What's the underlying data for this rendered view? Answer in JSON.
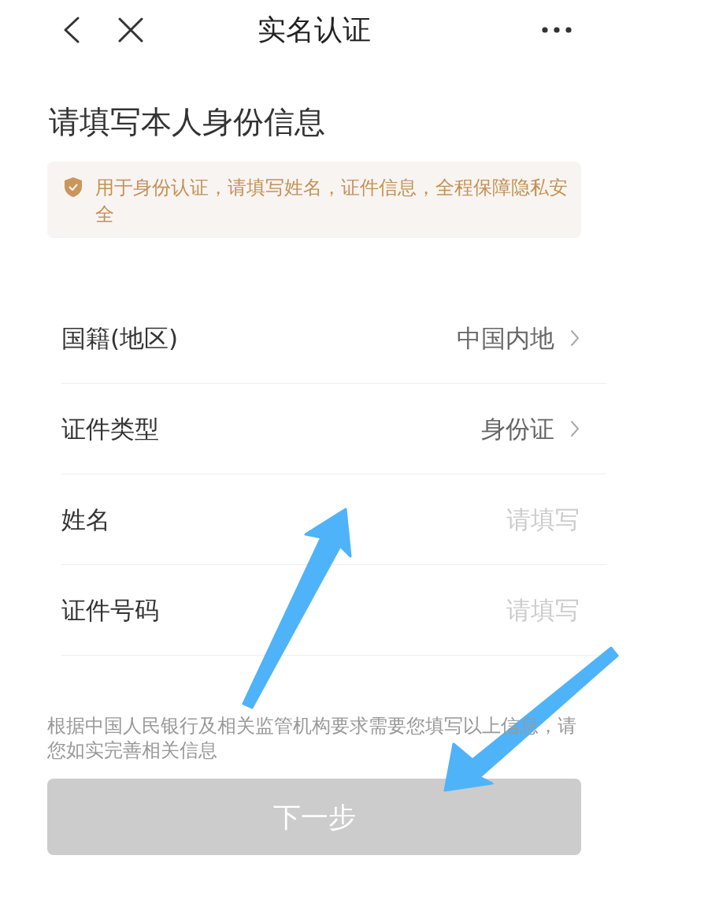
{
  "nav_bar": {
    "title": "实名认证"
  },
  "heading": "请填写本人身份信息",
  "notice": {
    "text": "用于身份认证，请填写姓名，证件信息，全程保障隐私安全"
  },
  "fields": [
    {
      "kind": "select",
      "label": "国籍(地区)",
      "value": "中国内地"
    },
    {
      "kind": "select",
      "label": "证件类型",
      "value": "身份证"
    },
    {
      "kind": "input",
      "label": "姓名",
      "placeholder": "请填写"
    },
    {
      "kind": "input",
      "label": "证件号码",
      "placeholder": "请填写"
    }
  ],
  "disclaimer": "根据中国人民银行及相关监管机构要求需要您填写以上信息，请您如实完善相关信息",
  "next_button": {
    "label": "下一步",
    "disabled": true
  }
}
